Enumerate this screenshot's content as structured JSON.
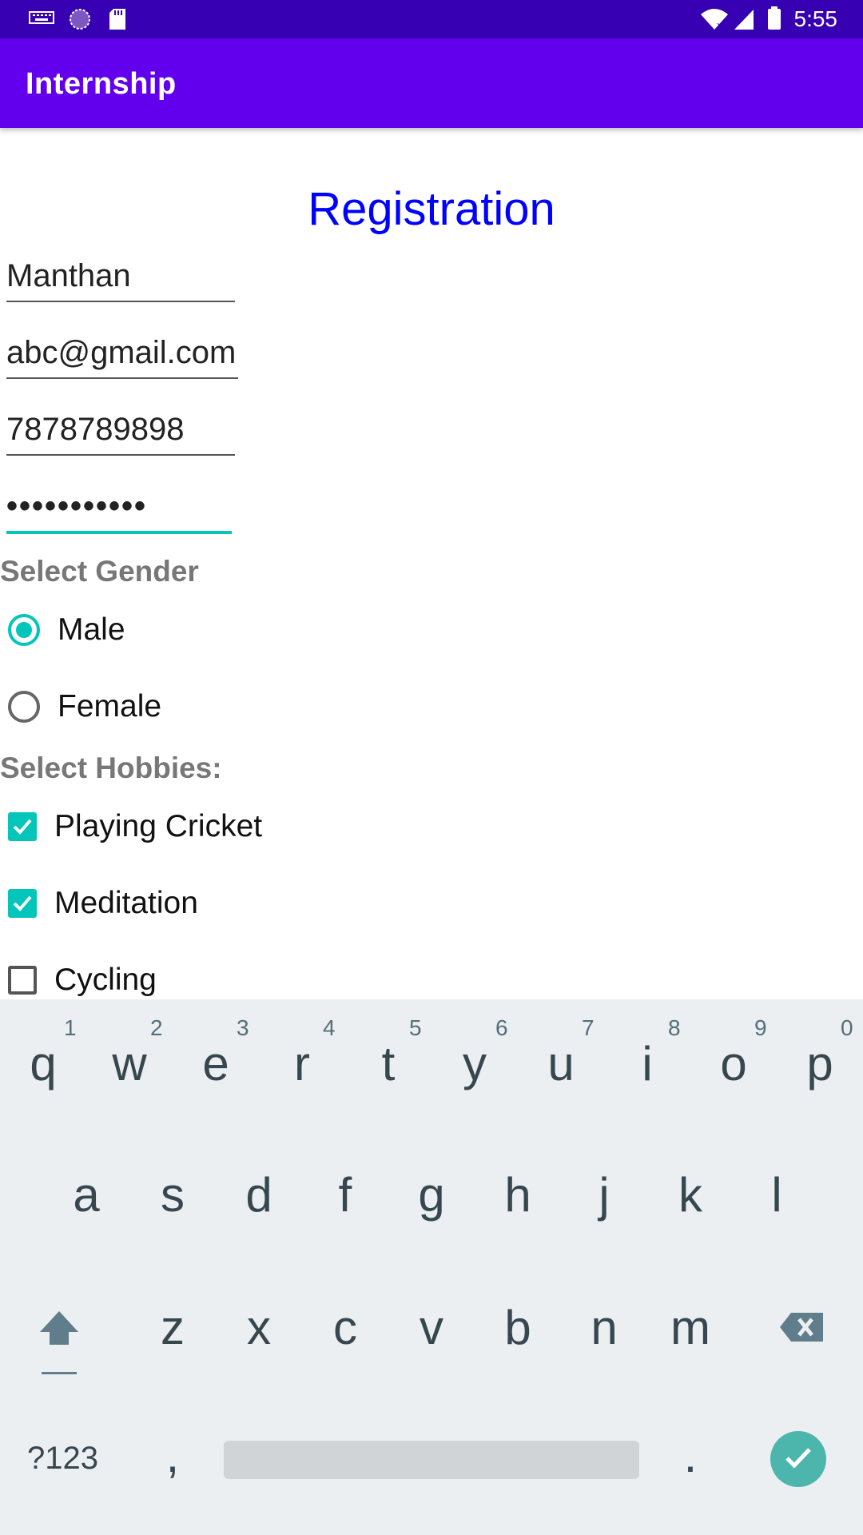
{
  "status_bar": {
    "time": "5:55",
    "icons": [
      "keyboard-icon",
      "sync-icon",
      "sd-card-icon",
      "wifi-icon",
      "signal-icon",
      "battery-icon"
    ]
  },
  "app_bar": {
    "title": "Internship"
  },
  "form": {
    "title": "Registration",
    "fields": {
      "name": "Manthan",
      "email": "abc@gmail.com",
      "phone": "7878789898",
      "password": "•••••••••••"
    },
    "gender": {
      "label": "Select Gender",
      "options": [
        {
          "label": "Male",
          "selected": true
        },
        {
          "label": "Female",
          "selected": false
        }
      ]
    },
    "hobbies": {
      "label": "Select Hobbies:",
      "options": [
        {
          "label": "Playing Cricket",
          "checked": true
        },
        {
          "label": "Meditation",
          "checked": true
        },
        {
          "label": "Cycling",
          "checked": false
        }
      ]
    }
  },
  "keyboard": {
    "row1": [
      "q",
      "w",
      "e",
      "r",
      "t",
      "y",
      "u",
      "i",
      "o",
      "p"
    ],
    "row1_hints": [
      "1",
      "2",
      "3",
      "4",
      "5",
      "6",
      "7",
      "8",
      "9",
      "0"
    ],
    "row2": [
      "a",
      "s",
      "d",
      "f",
      "g",
      "h",
      "j",
      "k",
      "l"
    ],
    "row3": [
      "z",
      "x",
      "c",
      "v",
      "b",
      "n",
      "m"
    ],
    "symbols": "?123",
    "comma": ",",
    "period": "."
  },
  "colors": {
    "status_bar": "#3700b3",
    "app_bar": "#6200ee",
    "title": "#0000ff",
    "accent": "#03c5b9",
    "enter_key": "#4db6ac"
  }
}
